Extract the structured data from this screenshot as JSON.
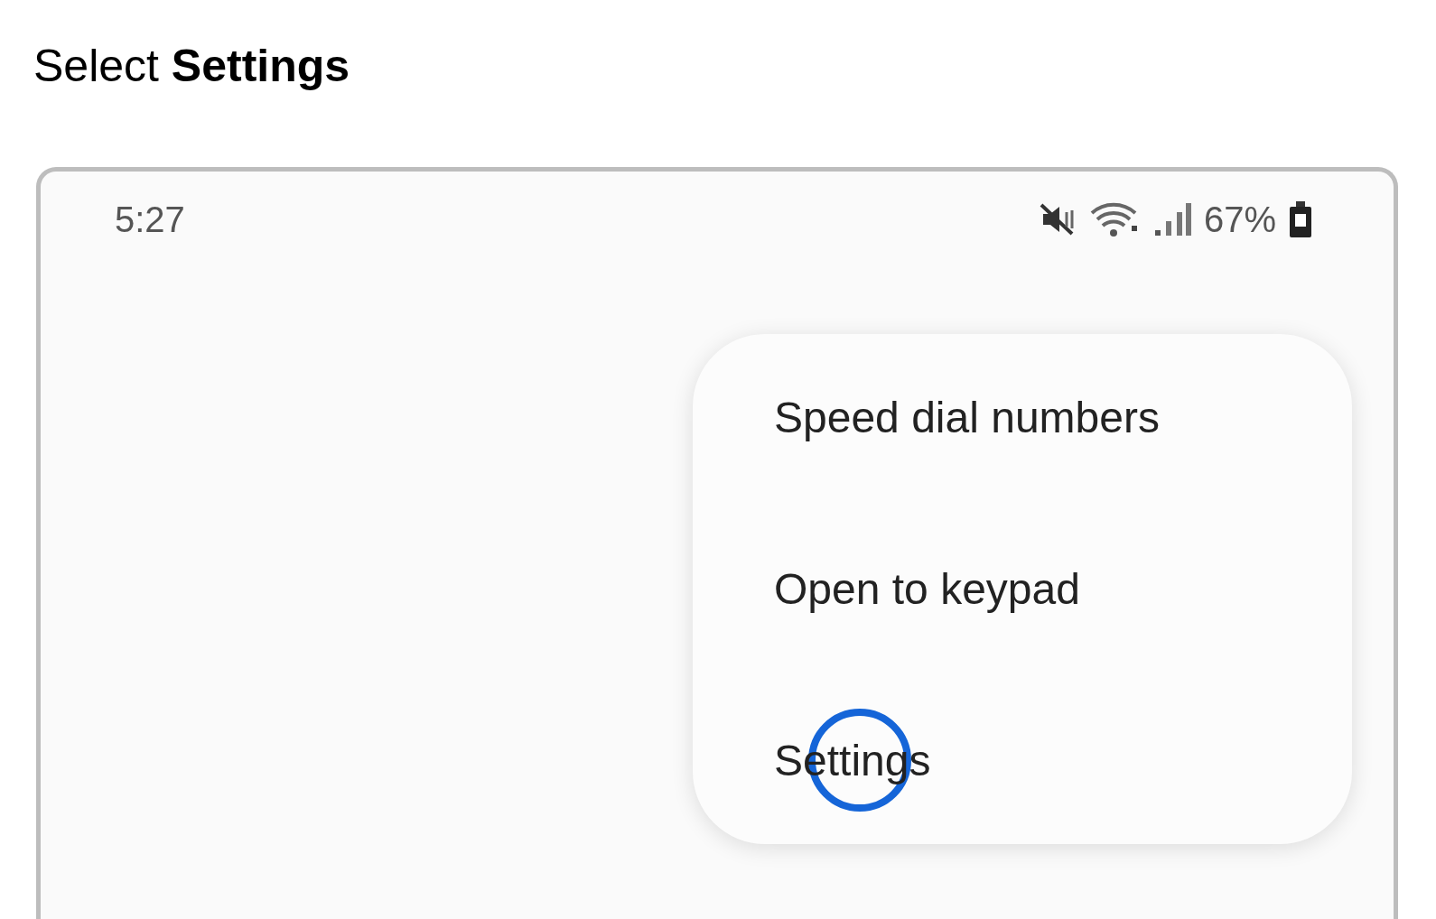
{
  "heading": "Select **Settings**",
  "status_bar": {
    "time": "5:27",
    "battery": "67%"
  },
  "menu": {
    "items": [
      {
        "label": "Speed dial numbers",
        "tapped": false
      },
      {
        "label": "Open to keypad",
        "tapped": false
      },
      {
        "label": "Settings",
        "tapped": true
      }
    ]
  }
}
